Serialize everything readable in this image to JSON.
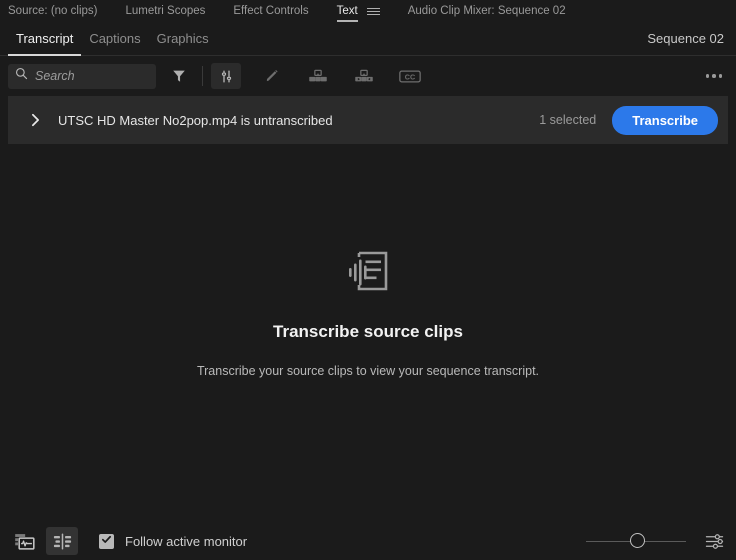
{
  "panel_tabs": [
    {
      "label": "Source: (no clips)",
      "active": false
    },
    {
      "label": "Lumetri Scopes",
      "active": false
    },
    {
      "label": "Effect Controls",
      "active": false
    },
    {
      "label": "Text",
      "active": true
    },
    {
      "label": "Audio Clip Mixer: Sequence 02",
      "active": false
    }
  ],
  "panel_menu_icon": "hamburger-menu-icon",
  "subtabs": [
    {
      "label": "Transcript",
      "active": true
    },
    {
      "label": "Captions",
      "active": false
    },
    {
      "label": "Graphics",
      "active": false
    }
  ],
  "sequence_label": "Sequence 02",
  "toolbar": {
    "search_icon": "search-icon",
    "search_value": "",
    "search_placeholder": "Search",
    "filter_icon": "filter-funnel-icon",
    "sort_icon": "sort-sliders-icon",
    "edit_icon": "pencil-edit-icon",
    "merge_icon": "merge-clips-icon",
    "split_icon": "split-clips-icon",
    "captions_icon": "cc-captions-icon",
    "overflow_icon": "more-options-icon"
  },
  "clip_row": {
    "expand_icon": "chevron-right-icon",
    "title": "UTSC HD Master No2pop.mp4 is untranscribed",
    "selected_count": "1 selected",
    "transcribe_label": "Transcribe",
    "transcribe_color": "#2c79ea"
  },
  "empty_state": {
    "icon": "transcript-document-icon",
    "title": "Transcribe source clips",
    "description": "Transcribe your source clips to view your sequence transcript."
  },
  "bottom_bar": {
    "timeline_view_icon": "timeline-clips-icon",
    "transcript_view_icon": "transcript-track-icon",
    "follow_checked": true,
    "check_icon": "checkmark-icon",
    "follow_label": "Follow active monitor",
    "zoom_slider_value": 45,
    "settings_icon": "settings-sliders-icon"
  },
  "colors": {
    "background": "#1b1b1b",
    "panel_row": "#2b2b2b",
    "accent": "#2c79ea",
    "text_primary": "#e8e8e8",
    "text_muted": "#8e8e8e"
  }
}
